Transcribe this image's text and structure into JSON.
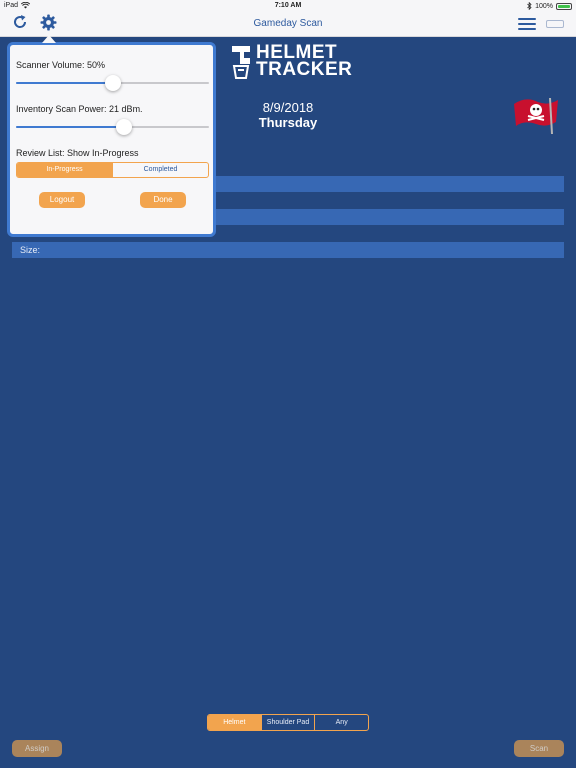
{
  "status": {
    "device": "iPad",
    "time": "7:10 AM",
    "battery": "100%"
  },
  "nav": {
    "title": "Gameday Scan"
  },
  "logo": {
    "line1": "HELMET",
    "line2": "TRACKER"
  },
  "date": {
    "date": "8/9/2018",
    "weekday": "Thursday"
  },
  "rows": [
    {
      "label": ""
    },
    {
      "label": ""
    },
    {
      "label": ""
    },
    {
      "label": "Size:"
    }
  ],
  "popover": {
    "scanner_volume_label": "Scanner Volume: 50%",
    "scanner_volume": 0.5,
    "scan_power_label": "Inventory Scan Power: 21 dBm.",
    "scan_power": 0.56,
    "review_list_label": "Review List: Show In-Progress",
    "review_options": [
      "In-Progress",
      "Completed"
    ],
    "review_selected": "In-Progress",
    "logout_label": "Logout",
    "done_label": "Done"
  },
  "equipment": {
    "options": [
      "Helmet",
      "Shoulder Pad",
      "Any"
    ],
    "selected": "Helmet"
  },
  "actions": {
    "assign_label": "Assign",
    "scan_label": "Scan"
  },
  "colors": {
    "background": "#24477f",
    "accent": "#f2a44e",
    "nav_tint": "#2d5a9e",
    "row": "#3768b4"
  }
}
